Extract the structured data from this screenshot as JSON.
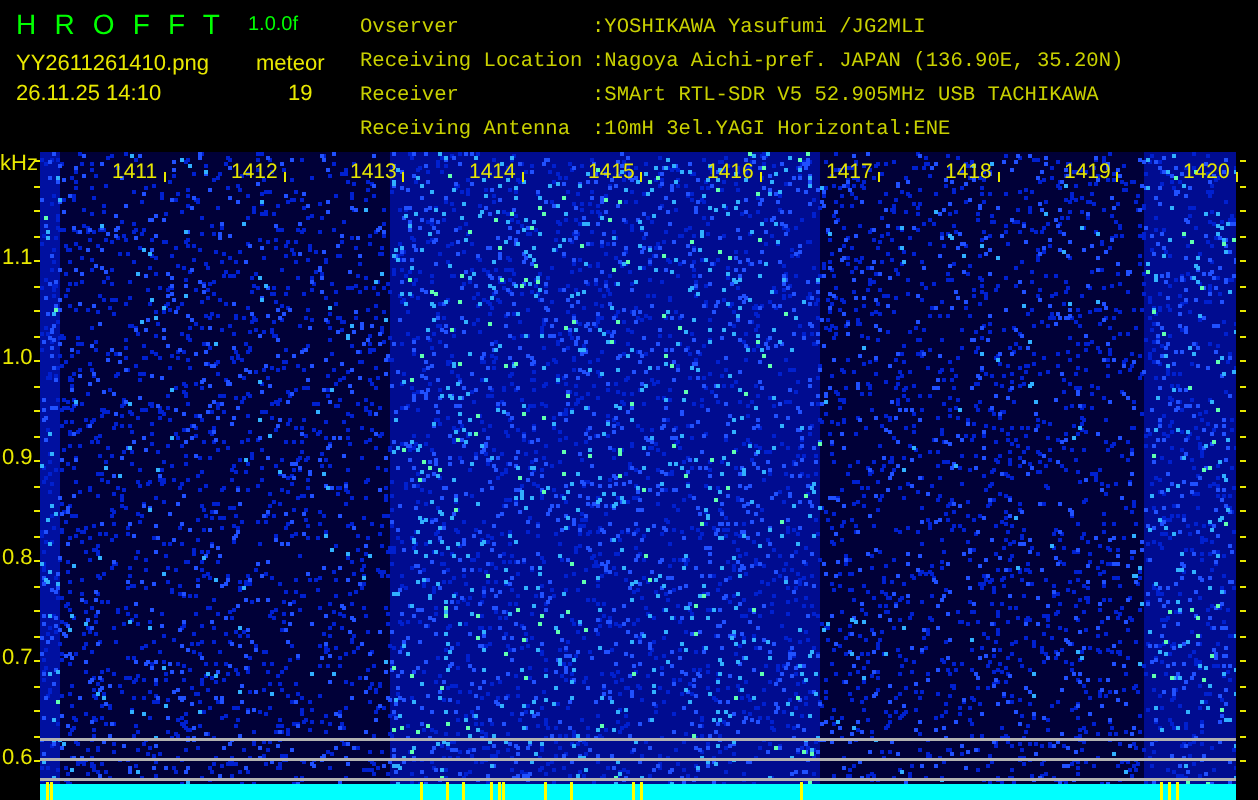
{
  "app": {
    "name": "H R O F F T",
    "version": "1.0.0f"
  },
  "file": {
    "name": "YY2611261410.png",
    "timestamp": "26.11.25 14:10"
  },
  "detection": {
    "type": "meteor",
    "count": "19"
  },
  "station": [
    {
      "label": "Ovserver",
      "value": ":YOSHIKAWA Yasufumi /JG2MLI"
    },
    {
      "label": "Receiving Location",
      "value": ":Nagoya Aichi-pref. JAPAN (136.90E, 35.20N)"
    },
    {
      "label": "Receiver",
      "value": ":SMArt RTL-SDR V5 52.905MHz USB TACHIKAWA"
    },
    {
      "label": "Receiving Antenna",
      "value": ":10mH 3el.YAGI Horizontal:ENE"
    }
  ],
  "spectrogram": {
    "unit": "kHz",
    "time_labels": [
      "1411",
      "1412",
      "1413",
      "1414",
      "1415",
      "1416",
      "1417",
      "1418",
      "1419",
      "1420"
    ],
    "freq_labels": [
      "1.1",
      "1.0",
      "0.9",
      "0.8",
      "0.7",
      "0.6"
    ]
  }
}
